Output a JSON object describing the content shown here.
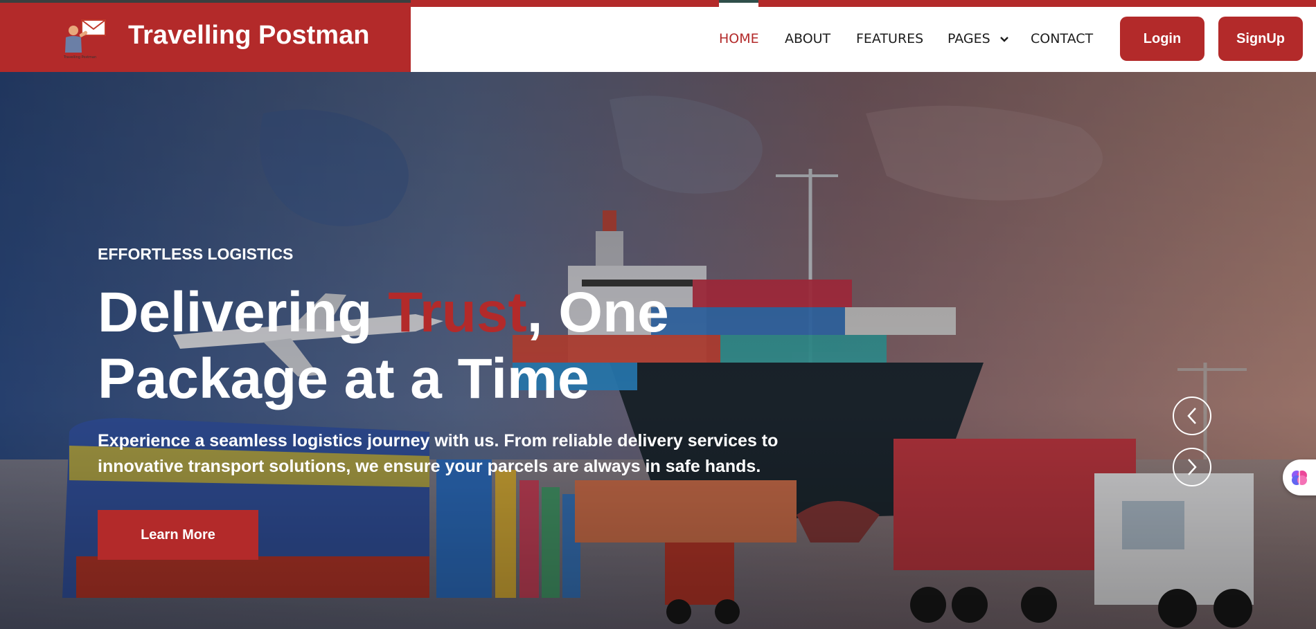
{
  "brand": {
    "name": "Travelling Postman",
    "logo_caption": "Travelling Postman",
    "color": "#b32a2a"
  },
  "nav": {
    "home": "HOME",
    "about": "ABOUT",
    "features": "FEATURES",
    "pages": "PAGES",
    "contact": "CONTACT",
    "active": "HOME"
  },
  "auth": {
    "login": "Login",
    "signup": "SignUp"
  },
  "hero": {
    "eyebrow": "EFFORTLESS LOGISTICS",
    "headline_before": "Delivering ",
    "headline_accent": "Trust",
    "headline_after": ", One Package at a Time",
    "subtext": "Experience a seamless logistics journey with us. From reliable delivery services to innovative transport solutions, we ensure your parcels are always in safe hands.",
    "cta": "Learn More"
  },
  "carousel": {
    "prev_icon": "chevron-left-icon",
    "next_icon": "chevron-right-icon"
  },
  "widget": {
    "icon": "brain-icon"
  },
  "colors": {
    "accent": "#b32a2a",
    "nav_text": "#1d1d1d",
    "white": "#ffffff"
  }
}
